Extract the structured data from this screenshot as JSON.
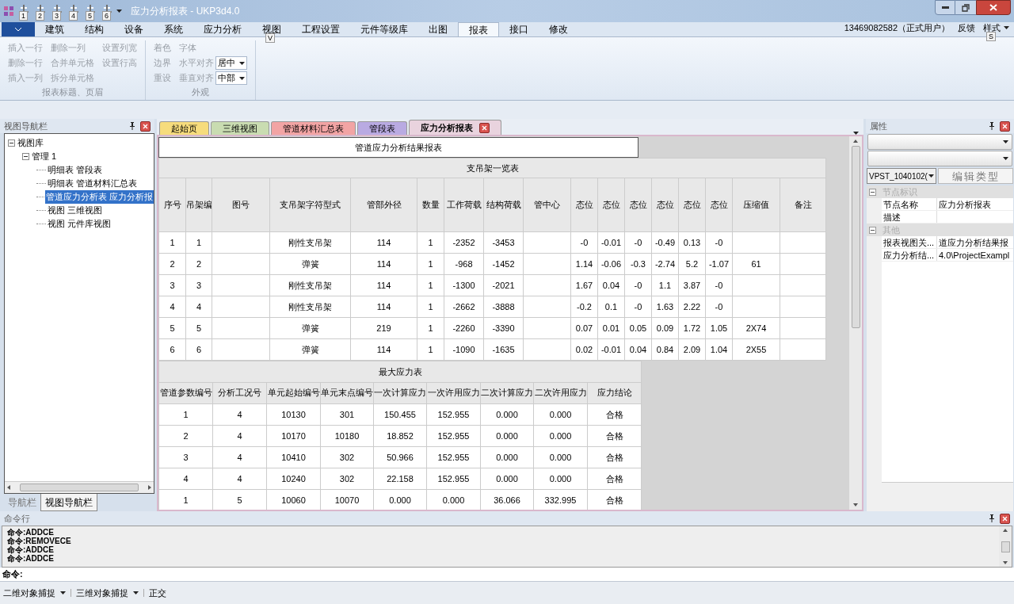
{
  "window": {
    "title": "应力分析报表 - UKP3d4.0"
  },
  "quick_access": [
    {
      "keytip": "1"
    },
    {
      "keytip": "2"
    },
    {
      "keytip": "3"
    },
    {
      "keytip": "4"
    },
    {
      "keytip": "5"
    },
    {
      "keytip": "6"
    }
  ],
  "ribbon": {
    "tabs": [
      {
        "label": "建筑",
        "selected": false
      },
      {
        "label": "结构",
        "selected": false
      },
      {
        "label": "设备",
        "selected": false
      },
      {
        "label": "系统",
        "selected": false
      },
      {
        "label": "应力分析",
        "selected": false
      },
      {
        "label": "视图",
        "selected": false,
        "keytip": "V"
      },
      {
        "label": "工程设置",
        "selected": false
      },
      {
        "label": "元件等级库",
        "selected": false
      },
      {
        "label": "出图",
        "selected": false
      },
      {
        "label": "报表",
        "selected": true
      },
      {
        "label": "接口",
        "selected": false
      },
      {
        "label": "修改",
        "selected": false
      }
    ],
    "account": "13469082582（正式用户）",
    "feedback": "反馈",
    "style_menu": {
      "label": "样式",
      "keytip": "S"
    },
    "groups": [
      {
        "title": "报表标题、页眉",
        "columns": [
          [
            {
              "label": "插入一行",
              "disabled": true
            },
            {
              "label": "删除一行",
              "disabled": true
            },
            {
              "label": "插入一列",
              "disabled": true
            }
          ],
          [
            {
              "label": "删除一列",
              "disabled": true
            },
            {
              "label": "合并单元格",
              "disabled": true
            },
            {
              "label": "拆分单元格",
              "disabled": true
            }
          ],
          [
            {
              "label": "设置列宽",
              "disabled": true
            },
            {
              "label": "设置行高",
              "disabled": true
            }
          ]
        ]
      },
      {
        "title": "外观",
        "columns": [
          [
            {
              "label": "着色",
              "disabled": true
            },
            {
              "label": "边界",
              "disabled": true
            },
            {
              "label": "重设",
              "disabled": true
            }
          ],
          [
            {
              "label": "字体",
              "disabled": true
            },
            {
              "label": "水平对齐",
              "disabled": true,
              "value": "居中"
            },
            {
              "label": "垂直对齐",
              "disabled": true,
              "value": "中部"
            }
          ]
        ]
      }
    ]
  },
  "navigator": {
    "title": "视图导航栏",
    "tree": [
      {
        "label": "视图库",
        "expanded": true,
        "selected": false,
        "children": [
          {
            "label": "管理 1",
            "expanded": true,
            "selected": false,
            "children": [
              {
                "label": "明细表 管段表",
                "selected": false
              },
              {
                "label": "明细表 管道材料汇总表",
                "selected": false
              },
              {
                "label": "管道应力分析表 应力分析报",
                "selected": true
              },
              {
                "label": "视图 三维视图",
                "selected": false
              },
              {
                "label": "视图 元件库视图",
                "selected": false
              }
            ]
          }
        ]
      }
    ],
    "bottom_tabs": [
      {
        "label": "导航栏",
        "selected": false
      },
      {
        "label": "视图导航栏",
        "selected": true
      }
    ]
  },
  "document_tabs": [
    {
      "label": "起始页",
      "color": "#f6dc7c",
      "selected": false
    },
    {
      "label": "三维视图",
      "color": "#c9dcb1",
      "selected": false
    },
    {
      "label": "管道材料汇总表",
      "color": "#f2a4a4",
      "selected": false
    },
    {
      "label": "管段表",
      "color": "#b9aae2",
      "selected": false
    },
    {
      "label": "应力分析报表",
      "color": "#e9d3de",
      "selected": true
    }
  ],
  "report": {
    "title": "管道应力分析结果报表",
    "support_table": {
      "title": "支吊架一览表",
      "columns": [
        "序号",
        "吊架编",
        "图号",
        "支吊架字符型式",
        "管部外径",
        "数量",
        "工作荷载",
        "结构荷载",
        "管中心",
        "态位",
        "态位",
        "态位",
        "态位",
        "态位",
        "态位",
        "压缩值",
        "备注"
      ],
      "rows": [
        [
          "1",
          "1",
          "",
          "刚性支吊架",
          "114",
          "1",
          "-2352",
          "-3453",
          "",
          "-0",
          "-0.01",
          "-0",
          "-0.49",
          "0.13",
          "-0",
          "",
          ""
        ],
        [
          "2",
          "2",
          "",
          "弹簧",
          "114",
          "1",
          "-968",
          "-1452",
          "",
          "1.14",
          "-0.06",
          "-0.3",
          "-2.74",
          "5.2",
          "-1.07",
          "61",
          ""
        ],
        [
          "3",
          "3",
          "",
          "刚性支吊架",
          "114",
          "1",
          "-1300",
          "-2021",
          "",
          "1.67",
          "0.04",
          "-0",
          "1.1",
          "3.87",
          "-0",
          "",
          ""
        ],
        [
          "4",
          "4",
          "",
          "刚性支吊架",
          "114",
          "1",
          "-2662",
          "-3888",
          "",
          "-0.2",
          "0.1",
          "-0",
          "1.63",
          "2.22",
          "-0",
          "",
          ""
        ],
        [
          "5",
          "5",
          "",
          "弹簧",
          "219",
          "1",
          "-2260",
          "-3390",
          "",
          "0.07",
          "0.01",
          "0.05",
          "0.09",
          "1.72",
          "1.05",
          "2X74",
          ""
        ],
        [
          "6",
          "6",
          "",
          "弹簧",
          "114",
          "1",
          "-1090",
          "-1635",
          "",
          "0.02",
          "-0.01",
          "0.04",
          "0.84",
          "2.09",
          "1.04",
          "2X55",
          ""
        ]
      ]
    },
    "stress_table": {
      "title": "最大应力表",
      "columns": [
        "管道参数编号",
        "分析工况号",
        "单元起始编号",
        "单元末点编号",
        "一次计算应力",
        "一次许用应力",
        "二次计算应力",
        "二次许用应力",
        "应力结论"
      ],
      "rows": [
        [
          "1",
          "4",
          "10130",
          "301",
          "150.455",
          "152.955",
          "0.000",
          "0.000",
          "合格"
        ],
        [
          "2",
          "4",
          "10170",
          "10180",
          "18.852",
          "152.955",
          "0.000",
          "0.000",
          "合格"
        ],
        [
          "3",
          "4",
          "10410",
          "302",
          "50.966",
          "152.955",
          "0.000",
          "0.000",
          "合格"
        ],
        [
          "4",
          "4",
          "10240",
          "302",
          "22.158",
          "152.955",
          "0.000",
          "0.000",
          "合格"
        ],
        [
          "1",
          "5",
          "10060",
          "10070",
          "0.000",
          "0.000",
          "36.066",
          "332.995",
          "合格"
        ]
      ]
    }
  },
  "properties": {
    "title": "属性",
    "type_selector": "VPST_1040102(",
    "edit_type": "编辑类型",
    "sections": [
      {
        "title": "节点标识",
        "expanded": true,
        "rows": [
          {
            "name": "节点名称",
            "value": "应力分析报表"
          },
          {
            "name": "描述",
            "value": ""
          }
        ]
      },
      {
        "title": "其他",
        "expanded": true,
        "rows": [
          {
            "name": "报表视图关...",
            "value": "道应力分析结果报"
          },
          {
            "name": "应力分析结...",
            "value": "4.0\\ProjectExampl"
          }
        ]
      }
    ]
  },
  "command_line": {
    "title": "命令行",
    "history": [
      "命令:ADDCE",
      "命令:REMOVECE",
      "命令:ADDCE",
      "命令:ADDCE"
    ],
    "prompt": "命令:"
  },
  "status_bar": [
    {
      "label": "二维对象捕捉",
      "dropdown": true
    },
    {
      "label": "三维对象捕捉",
      "dropdown": true
    },
    {
      "label": "正交",
      "dropdown": false
    }
  ]
}
